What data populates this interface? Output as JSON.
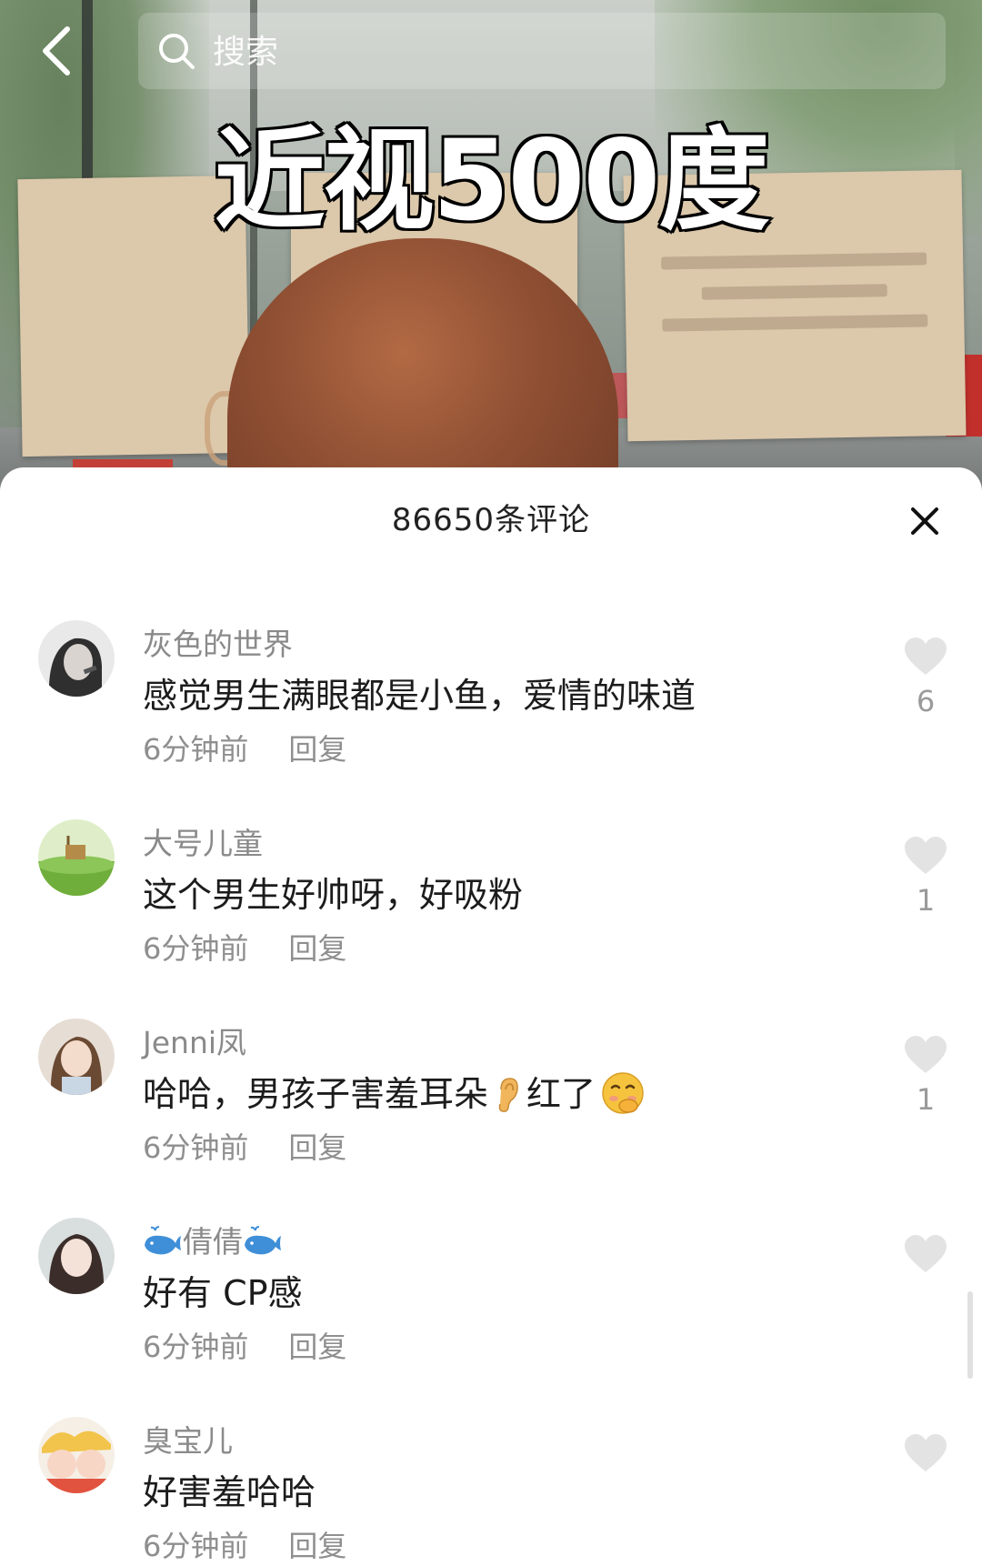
{
  "search": {
    "placeholder": "搜索"
  },
  "video": {
    "caption": "近视500度"
  },
  "comments_panel": {
    "title": "86650条评论",
    "items": [
      {
        "author": "灰色的世界",
        "text": "感觉男生满眼都是小鱼，爱情的味道",
        "time": "6分钟前",
        "reply": "回复",
        "likes": "6"
      },
      {
        "author": "大号儿童",
        "text": "这个男生好帅呀，好吸粉",
        "time": "6分钟前",
        "reply": "回复",
        "likes": "1"
      },
      {
        "author": "Jenni凤",
        "text_before_ear": "哈哈，男孩子害羞耳朵",
        "text_after_ear": "红了",
        "time": "6分钟前",
        "reply": "回复",
        "likes": "1"
      },
      {
        "author": "倩倩",
        "text": "好有 CP感",
        "time": "6分钟前",
        "reply": "回复",
        "likes": ""
      },
      {
        "author": "臭宝儿",
        "text": "好害羞哈哈",
        "time": "6分钟前",
        "reply": "回复",
        "likes": ""
      }
    ]
  },
  "colors": {
    "accent_text": "#1c1c1c",
    "secondary_text": "#8a8a8a",
    "heart": "#e3e3e3"
  },
  "icons": [
    "back-icon",
    "search-icon",
    "close-icon",
    "heart-icon",
    "ear-icon",
    "smile-icon",
    "whale-icon"
  ]
}
